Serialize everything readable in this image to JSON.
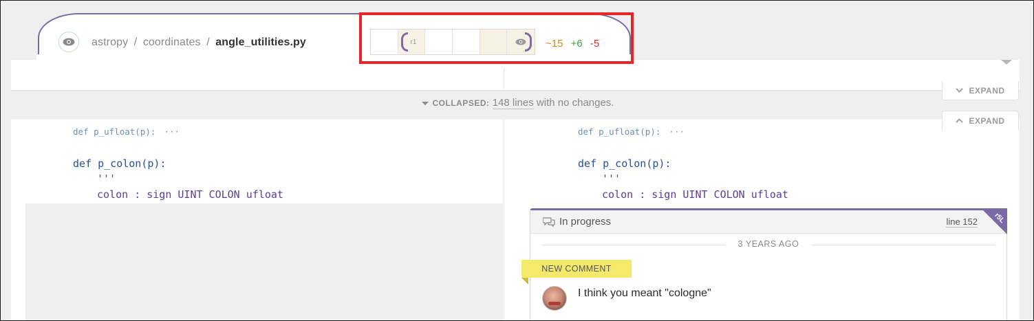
{
  "file_header": {
    "breadcrumb": {
      "part1": "astropy",
      "separator": "/",
      "part2": "coordinates",
      "file": "angle_utilities.py"
    },
    "revision_slider": {
      "label": "r1"
    },
    "stats": {
      "modified": "~15",
      "added": "+6",
      "removed": "-5"
    }
  },
  "expand": {
    "down_label": "EXPAND",
    "up_label": "EXPAND"
  },
  "collapsed": {
    "label": "COLLAPSED:",
    "lines": "148 lines",
    "suffix": " with no changes."
  },
  "code": {
    "left": {
      "collapsed_def": "def p_ufloat(p):",
      "ellipsis": "···",
      "def_kw": "def",
      "def_name": "p_colon(p):",
      "docstring": "'''",
      "rule_name": "colon",
      "rule_body": ": sign UINT COLON ufloat"
    },
    "right": {
      "collapsed_def": "def p_ufloat(p):",
      "ellipsis": "···",
      "def_kw": "def",
      "def_name": "p_colon(p):",
      "docstring": "'''",
      "rule_name": "colon",
      "rule_body": ": sign UINT COLON ufloat"
    }
  },
  "comment": {
    "status": "In progress",
    "line_ref": "line 152",
    "ribbon": "r5L",
    "timestamp": "3 YEARS AGO",
    "badge": "NEW COMMENT",
    "text": "I think you meant \"cologne\""
  },
  "colors": {
    "accent_purple": "#7a6aa6",
    "highlight_red": "#e8262a",
    "badge_yellow": "#f4e96a",
    "stat_modified": "#d08a1c",
    "stat_added": "#3aa63a",
    "stat_removed": "#cc3333"
  },
  "icons": {
    "file_visibility": "eye-icon",
    "slider_visibility": "eye-icon",
    "comments": "speech-bubbles-icon",
    "expand_down": "chevron-down-icon",
    "expand_up": "chevron-up-icon"
  }
}
